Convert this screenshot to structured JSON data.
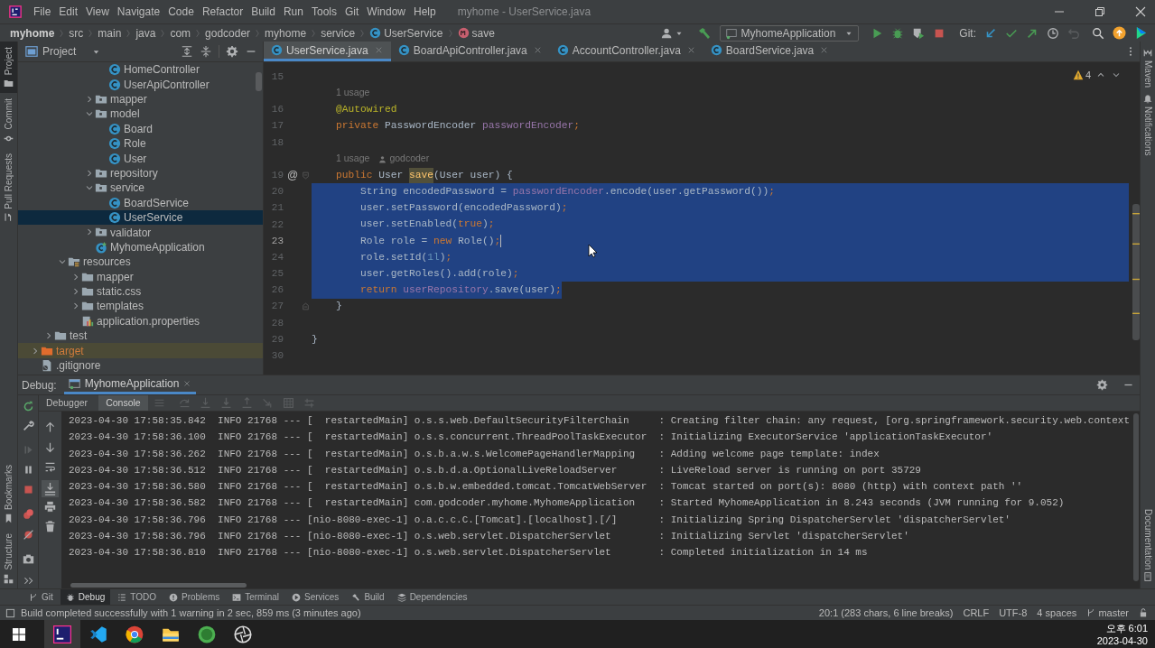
{
  "window": {
    "title": "myhome - UserService.java"
  },
  "menu": [
    "File",
    "Edit",
    "View",
    "Navigate",
    "Code",
    "Refactor",
    "Build",
    "Run",
    "Tools",
    "Git",
    "Window",
    "Help"
  ],
  "breadcrumbs": [
    {
      "label": "myhome",
      "kind": "project"
    },
    {
      "label": "src",
      "kind": "dir"
    },
    {
      "label": "main",
      "kind": "dir"
    },
    {
      "label": "java",
      "kind": "dir"
    },
    {
      "label": "com",
      "kind": "dir"
    },
    {
      "label": "godcoder",
      "kind": "dir"
    },
    {
      "label": "myhome",
      "kind": "dir"
    },
    {
      "label": "service",
      "kind": "dir"
    },
    {
      "label": "UserService",
      "kind": "class"
    },
    {
      "label": "save",
      "kind": "method"
    }
  ],
  "toolbar": {
    "run_config": "MyhomeApplication",
    "git_label": "Git:"
  },
  "left_strip": [
    {
      "label": "Project",
      "selected": true
    },
    {
      "label": "Commit",
      "selected": false
    },
    {
      "label": "Pull Requests",
      "selected": false
    }
  ],
  "left_strip_bottom": [
    {
      "label": "Bookmarks",
      "selected": false
    },
    {
      "label": "Structure",
      "selected": false
    }
  ],
  "right_strip": [
    "Maven",
    "Notifications"
  ],
  "right_strip_bottom": [
    "Documentation"
  ],
  "project_panel": {
    "title": "Project",
    "tree": [
      {
        "children": [
          {
            "children": [
              {
                "children": [
                  {
                    "children": [
                      {
                        "children": [
                          {
                            "label": "HomeController",
                            "kind": "class",
                            "selected": false
                          },
                          {
                            "label": "UserApiController",
                            "kind": "class",
                            "selected": false
                          }
                        ]
                      },
                      {
                        "label": "mapper",
                        "kind": "package",
                        "expanded": false,
                        "selected": false
                      },
                      {
                        "label": "model",
                        "kind": "package",
                        "expanded": true,
                        "selected": false,
                        "children": [
                          {
                            "label": "Board",
                            "kind": "class",
                            "selected": false
                          },
                          {
                            "label": "Role",
                            "kind": "class",
                            "selected": false
                          },
                          {
                            "label": "User",
                            "kind": "class",
                            "selected": false
                          }
                        ]
                      },
                      {
                        "label": "repository",
                        "kind": "package",
                        "expanded": false,
                        "selected": false
                      },
                      {
                        "label": "service",
                        "kind": "package",
                        "expanded": true,
                        "selected": false,
                        "children": [
                          {
                            "label": "BoardService",
                            "kind": "class",
                            "selected": false
                          },
                          {
                            "label": "UserService",
                            "kind": "class",
                            "selected": true
                          }
                        ]
                      },
                      {
                        "label": "validator",
                        "kind": "package",
                        "expanded": false,
                        "selected": false
                      },
                      {
                        "label": "MyhomeApplication",
                        "kind": "app",
                        "selected": false
                      }
                    ]
                  }
                ]
              },
              {
                "label": "resources",
                "kind": "resources",
                "expanded": true,
                "selected": false,
                "children": [
                  {
                    "label": "mapper",
                    "kind": "folder",
                    "expanded": false,
                    "selected": false
                  },
                  {
                    "label": "static.css",
                    "kind": "folder",
                    "expanded": false,
                    "selected": false
                  },
                  {
                    "label": "templates",
                    "kind": "folder",
                    "expanded": false,
                    "selected": false
                  },
                  {
                    "label": "application.properties",
                    "kind": "properties",
                    "selected": false
                  }
                ]
              }
            ]
          },
          {
            "label": "test",
            "kind": "folder",
            "expanded": false,
            "selected": false
          }
        ]
      },
      {
        "label": "target",
        "kind": "excluded",
        "expanded": false,
        "selected": false
      },
      {
        "label": ".gitignore",
        "kind": "gitignore",
        "selected": false
      }
    ]
  },
  "editor_tabs": [
    {
      "label": "UserService.java",
      "selected": true
    },
    {
      "label": "BoardApiController.java",
      "selected": false
    },
    {
      "label": "AccountController.java",
      "selected": false
    },
    {
      "label": "BoardService.java",
      "selected": false
    }
  ],
  "editor": {
    "warning_count": "4",
    "lines": [
      {
        "kind": "line",
        "n": "15",
        "selected": false
      },
      {
        "kind": "hint",
        "usage": "1 usage"
      },
      {
        "kind": "line",
        "n": "16",
        "segs": [
          {
            "t": "    @Autowired",
            "kind": "annotation"
          }
        ],
        "selected": false
      },
      {
        "kind": "line",
        "n": "17",
        "segs": [
          {
            "t": "    private ",
            "kind": "keyword"
          },
          {
            "t": "PasswordEncoder ",
            "kind": "plain"
          },
          {
            "t": "passwordEncoder",
            "kind": "field"
          },
          {
            "t": ";",
            "kind": "keyword"
          }
        ],
        "selected": false
      },
      {
        "kind": "line",
        "n": "18",
        "selected": false
      },
      {
        "kind": "hint",
        "usage": "1 usage",
        "author": "godcoder"
      },
      {
        "kind": "line",
        "n": "19",
        "gutter": "@",
        "fold_start": true,
        "segs": [
          {
            "t": "    public ",
            "kind": "keyword"
          },
          {
            "t": "User ",
            "kind": "plain"
          },
          {
            "t": "save",
            "kind": "declaration"
          },
          {
            "t": "(User user) {",
            "kind": "plain"
          }
        ],
        "selected": false
      },
      {
        "kind": "line",
        "n": "20",
        "segs": [
          {
            "t": "        String encodedPassword = ",
            "kind": "plain"
          },
          {
            "t": "passwordEncoder",
            "kind": "field"
          },
          {
            "t": ".encode(user.getPassword())",
            "kind": "plain"
          },
          {
            "t": ";",
            "kind": "keyword"
          }
        ],
        "selected": true
      },
      {
        "kind": "line",
        "n": "21",
        "segs": [
          {
            "t": "        user.setPassword(encodedPassword)",
            "kind": "plain"
          },
          {
            "t": ";",
            "kind": "keyword"
          }
        ],
        "selected": true
      },
      {
        "kind": "line",
        "n": "22",
        "segs": [
          {
            "t": "        user.setEnabled(",
            "kind": "plain"
          },
          {
            "t": "true",
            "kind": "keyword"
          },
          {
            "t": ")",
            "kind": "plain"
          },
          {
            "t": ";",
            "kind": "keyword"
          }
        ],
        "selected": true
      },
      {
        "kind": "line",
        "n": "23",
        "caret": true,
        "segs": [
          {
            "t": "        Role role = ",
            "kind": "plain"
          },
          {
            "t": "new ",
            "kind": "keyword"
          },
          {
            "t": "Role()",
            "kind": "plain"
          },
          {
            "t": ";",
            "kind": "keyword"
          }
        ],
        "selected": true
      },
      {
        "kind": "line",
        "n": "24",
        "segs": [
          {
            "t": "        role.setId(",
            "kind": "plain"
          },
          {
            "t": "1l",
            "kind": "number"
          },
          {
            "t": ")",
            "kind": "plain"
          },
          {
            "t": ";",
            "kind": "keyword"
          }
        ],
        "selected": true
      },
      {
        "kind": "line",
        "n": "25",
        "segs": [
          {
            "t": "        user.getRoles().add(role)",
            "kind": "plain"
          },
          {
            "t": ";",
            "kind": "keyword"
          }
        ],
        "selected": true
      },
      {
        "kind": "line",
        "n": "26",
        "segs": [
          {
            "t": "        return ",
            "kind": "keyword"
          },
          {
            "t": "userRepository",
            "kind": "field"
          },
          {
            "t": ".save(user)",
            "kind": "plain"
          },
          {
            "t": ";",
            "kind": "keyword"
          }
        ],
        "selected": true
      },
      {
        "kind": "line",
        "n": "27",
        "fold_end": true,
        "segs": [
          {
            "t": "    }",
            "kind": "plain"
          }
        ],
        "selected": false
      },
      {
        "kind": "line",
        "n": "28",
        "selected": false
      },
      {
        "kind": "line",
        "n": "29",
        "segs": [
          {
            "t": "}",
            "kind": "plain"
          }
        ],
        "selected": false
      },
      {
        "kind": "line",
        "n": "30",
        "selected": false
      }
    ]
  },
  "debug": {
    "title": "Debug:",
    "tabs": [
      {
        "label": "MyhomeApplication",
        "selected": true
      }
    ],
    "subtabs": [
      {
        "label": "Debugger",
        "selected": false
      },
      {
        "label": "Console",
        "selected": true
      }
    ],
    "console": [
      "2023-04-30 17:58:35.842  INFO 21768 --- [  restartedMain] o.s.s.web.DefaultSecurityFilterChain     : Creating filter chain: any request, [org.springframework.security.web.context",
      "2023-04-30 17:58:36.100  INFO 21768 --- [  restartedMain] o.s.s.concurrent.ThreadPoolTaskExecutor  : Initializing ExecutorService 'applicationTaskExecutor'",
      "2023-04-30 17:58:36.262  INFO 21768 --- [  restartedMain] o.s.b.a.w.s.WelcomePageHandlerMapping    : Adding welcome page template: index",
      "2023-04-30 17:58:36.512  INFO 21768 --- [  restartedMain] o.s.b.d.a.OptionalLiveReloadServer       : LiveReload server is running on port 35729",
      "2023-04-30 17:58:36.580  INFO 21768 --- [  restartedMain] o.s.b.w.embedded.tomcat.TomcatWebServer  : Tomcat started on port(s): 8080 (http) with context path ''",
      "2023-04-30 17:58:36.582  INFO 21768 --- [  restartedMain] com.godcoder.myhome.MyhomeApplication    : Started MyhomeApplication in 8.243 seconds (JVM running for 9.052)",
      "2023-04-30 17:58:36.796  INFO 21768 --- [nio-8080-exec-1] o.a.c.c.C.[Tomcat].[localhost].[/]       : Initializing Spring DispatcherServlet 'dispatcherServlet'",
      "2023-04-30 17:58:36.796  INFO 21768 --- [nio-8080-exec-1] o.s.web.servlet.DispatcherServlet        : Initializing Servlet 'dispatcherServlet'",
      "2023-04-30 17:58:36.810  INFO 21768 --- [nio-8080-exec-1] o.s.web.servlet.DispatcherServlet        : Completed initialization in 14 ms"
    ]
  },
  "tool_windows": [
    {
      "label": "Git",
      "kind": "git",
      "selected": false
    },
    {
      "label": "Debug",
      "kind": "debug",
      "selected": true
    },
    {
      "label": "TODO",
      "kind": "todo",
      "selected": false
    },
    {
      "label": "Problems",
      "kind": "problems",
      "selected": false
    },
    {
      "label": "Terminal",
      "kind": "terminal",
      "selected": false
    },
    {
      "label": "Services",
      "kind": "services",
      "selected": false
    },
    {
      "label": "Build",
      "kind": "build",
      "selected": false
    },
    {
      "label": "Dependencies",
      "kind": "dependencies",
      "selected": false
    }
  ],
  "status_bar": {
    "message": "Build completed successfully with 1 warning in 2 sec, 859 ms (3 minutes ago)",
    "items": [
      {
        "label": "20:1 (283 chars, 6 line breaks)",
        "kind": "text"
      },
      {
        "label": "CRLF",
        "kind": "text"
      },
      {
        "label": "UTF-8",
        "kind": "text"
      },
      {
        "label": "4 spaces",
        "kind": "text"
      },
      {
        "label": "master",
        "kind": "branch"
      }
    ]
  },
  "taskbar": {
    "time": "오후 6:01",
    "date": "2023-04-30"
  }
}
